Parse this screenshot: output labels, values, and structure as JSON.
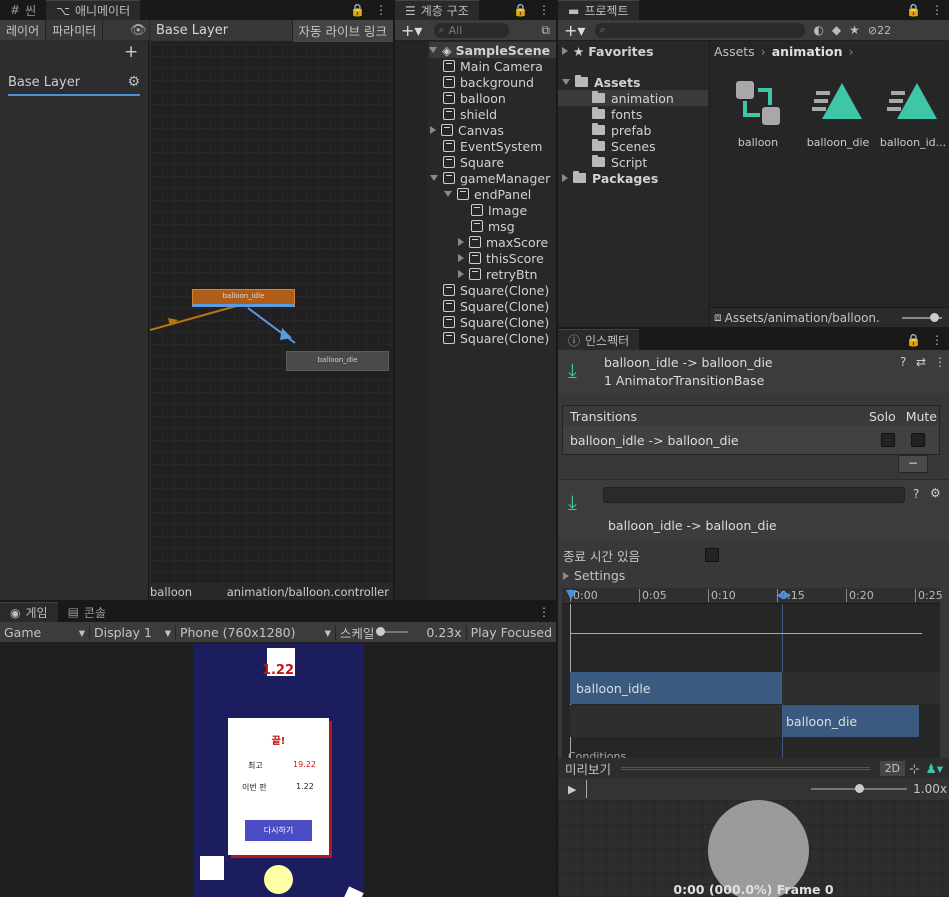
{
  "animator": {
    "tabs": [
      "씬",
      "애니메이터"
    ],
    "subtabs": [
      "레이어",
      "파라미터"
    ],
    "layer_title": "Base Layer",
    "auto_live_link": "자동 라이브 링크",
    "layer_item": "Base Layer",
    "states": {
      "idle": "balloon_idle",
      "die": "balloon_die"
    },
    "footer_left": "balloon",
    "footer_right": "animation/balloon.controller"
  },
  "hierarchy": {
    "tab": "계층 구조",
    "search_placeholder": "All",
    "scene": "SampleScene",
    "items": [
      {
        "label": "Main Camera"
      },
      {
        "label": "background"
      },
      {
        "label": "balloon"
      },
      {
        "label": "shield"
      },
      {
        "label": "Canvas"
      },
      {
        "label": "EventSystem"
      },
      {
        "label": "Square"
      },
      {
        "label": "gameManager"
      },
      {
        "label": "endPanel"
      },
      {
        "label": "Image"
      },
      {
        "label": "msg"
      },
      {
        "label": "maxScore"
      },
      {
        "label": "thisScore"
      },
      {
        "label": "retryBtn"
      },
      {
        "label": "Square(Clone)"
      },
      {
        "label": "Square(Clone)"
      },
      {
        "label": "Square(Clone)"
      },
      {
        "label": "Square(Clone)"
      }
    ]
  },
  "project": {
    "tab": "프로젝트",
    "badge": "22",
    "favorites": "Favorites",
    "assets": "Assets",
    "folders": [
      "animation",
      "fonts",
      "prefab",
      "Scenes",
      "Script"
    ],
    "packages": "Packages",
    "breadcrumb": [
      "Assets",
      "animation"
    ],
    "files": [
      "balloon",
      "balloon_die",
      "balloon_id..."
    ],
    "footer_path": "Assets/animation/balloon."
  },
  "inspector": {
    "tab": "인스펙터",
    "title": "balloon_idle -> balloon_die",
    "subtitle": "1 AnimatorTransitionBase",
    "transitions_header": "Transitions",
    "solo": "Solo",
    "mute": "Mute",
    "transition_row": "balloon_idle -> balloon_die",
    "minus": "−",
    "transition_name": "balloon_idle -> balloon_die",
    "has_exit_time": "종료 시간 있음",
    "settings": "Settings",
    "ticks": [
      "0:00",
      "0:05",
      "0:10",
      "0:15",
      "0:20",
      "0:25"
    ],
    "clip_idle": "balloon_idle",
    "clip_die": "balloon_die",
    "conditions": "Conditions",
    "preview_label": "미리보기",
    "preview_2d": "2D",
    "speed": "1.00x",
    "frame_readout": "0:00 (000.0%) Frame 0"
  },
  "game": {
    "tabs": [
      "게임",
      "콘솔"
    ],
    "mode": "Game",
    "display": "Display 1",
    "resolution": "Phone (760x1280)",
    "scale_label": "스케일",
    "scale_value": "0.23x",
    "play_focused": "Play Focused",
    "score_top": "1.22",
    "panel_title": "끝!",
    "best_label": "최고",
    "best_value": "19.22",
    "this_label": "이번 판",
    "this_value": "1.22",
    "retry": "다시하기"
  },
  "colors": {
    "accent": "#4a90d9",
    "state_orange": "#b05d1a",
    "game_bg": "#1c1d5e",
    "retry_btn": "#4b4bc4",
    "score_red": "#cc1111",
    "asset_teal": "#3fc6a8"
  }
}
